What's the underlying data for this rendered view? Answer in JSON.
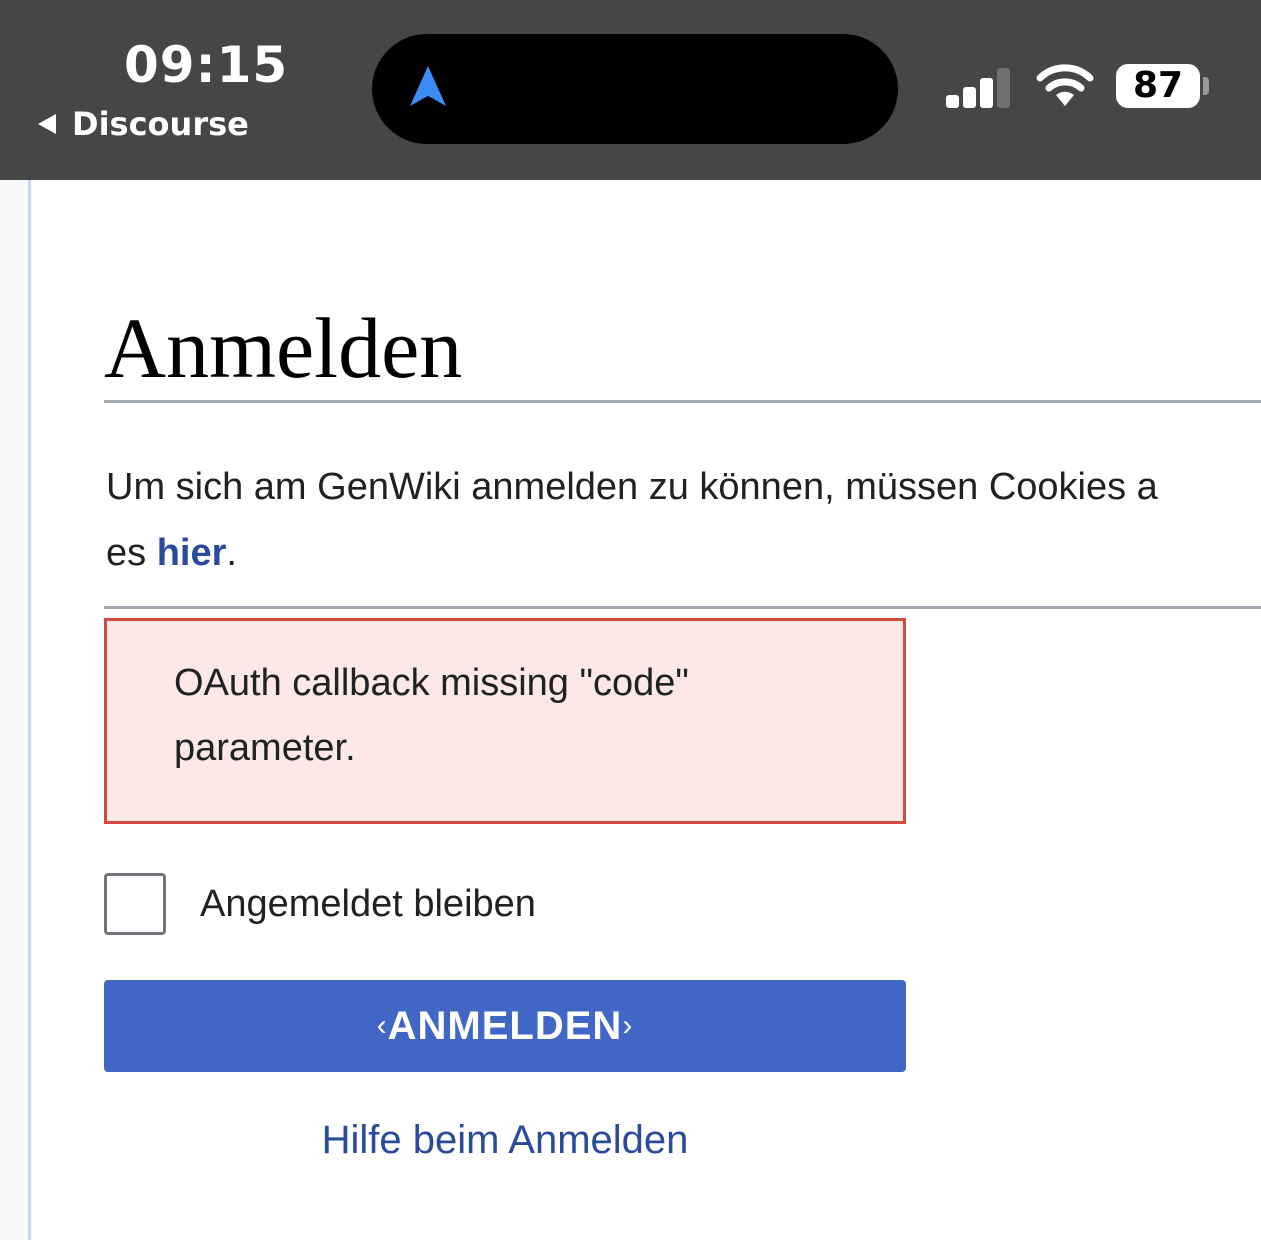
{
  "status_bar": {
    "time": "09:15",
    "back_app": "Discourse",
    "battery": "87",
    "icons": [
      "navigation-arrow-icon",
      "cellular-signal-icon",
      "wifi-icon",
      "battery-icon"
    ]
  },
  "page": {
    "title": "Anmelden",
    "intro_text": "Um sich am GenWiki anmelden zu können, müssen Cookies a",
    "intro_line2_prefix": "es ",
    "intro_link": "hier",
    "intro_line2_suffix": ".",
    "error_message": "OAuth callback missing \"code\" parameter.",
    "remember_label": "Angemeldet bleiben",
    "remember_checked": false,
    "submit": {
      "bracket_left": "‹",
      "label": "ANMELDEN",
      "bracket_right": "›"
    },
    "help_link": "Hilfe beim Anmelden"
  },
  "colors": {
    "status_bar_bg": "#454646",
    "accent_button": "#4066c6",
    "link": "#2a4b9b",
    "error_bg": "#fbe8e7",
    "error_border": "#d44a40"
  }
}
